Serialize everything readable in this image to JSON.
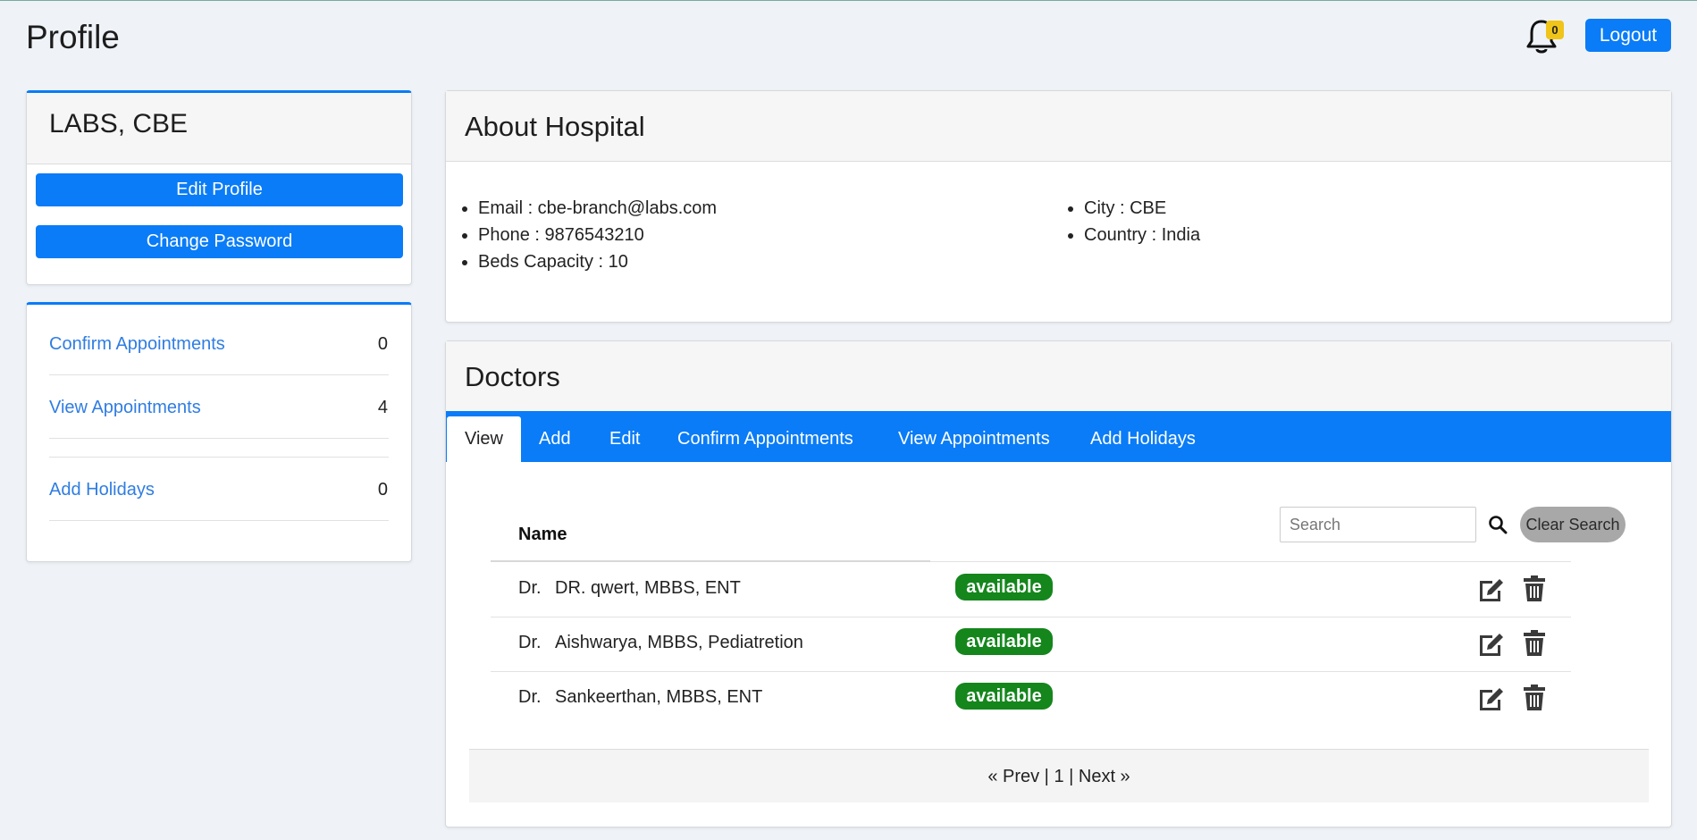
{
  "header": {
    "title": "Profile",
    "notification_count": "0",
    "logout_label": "Logout"
  },
  "profile": {
    "name": "LABS, CBE",
    "edit_label": "Edit Profile",
    "change_password_label": "Change Password"
  },
  "stats": [
    {
      "label": "Confirm Appointments",
      "count": "0"
    },
    {
      "label": "View Appointments",
      "count": "4"
    },
    {
      "label": "Add Holidays",
      "count": "0"
    }
  ],
  "about": {
    "title": "About Hospital",
    "left": [
      "Email : cbe-branch@labs.com",
      "Phone : 9876543210",
      "Beds Capacity : 10"
    ],
    "right": [
      "City : CBE",
      "Country : India"
    ]
  },
  "doctors": {
    "title": "Doctors",
    "tabs": [
      "View",
      "Add",
      "Edit",
      "Confirm Appointments",
      "View Appointments",
      "Add Holidays"
    ],
    "active_tab": "View",
    "search_placeholder": "Search",
    "clear_label": "Clear Search",
    "column_name": "Name",
    "rows": [
      {
        "prefix": "Dr.",
        "name": "DR. qwert, MBBS, ENT",
        "status": "available"
      },
      {
        "prefix": "Dr.",
        "name": "Aishwarya, MBBS, Pediatretion",
        "status": "available"
      },
      {
        "prefix": "Dr.",
        "name": "Sankeerthan, MBBS, ENT",
        "status": "available"
      }
    ],
    "pager": {
      "prev": "« Prev",
      "sep1": " | ",
      "page": "1",
      "sep2": " | ",
      "next": "Next »"
    }
  },
  "colors": {
    "primary": "#0a7cf7",
    "link": "#2f7de2",
    "available": "#14861c",
    "badge": "#f0c419"
  }
}
